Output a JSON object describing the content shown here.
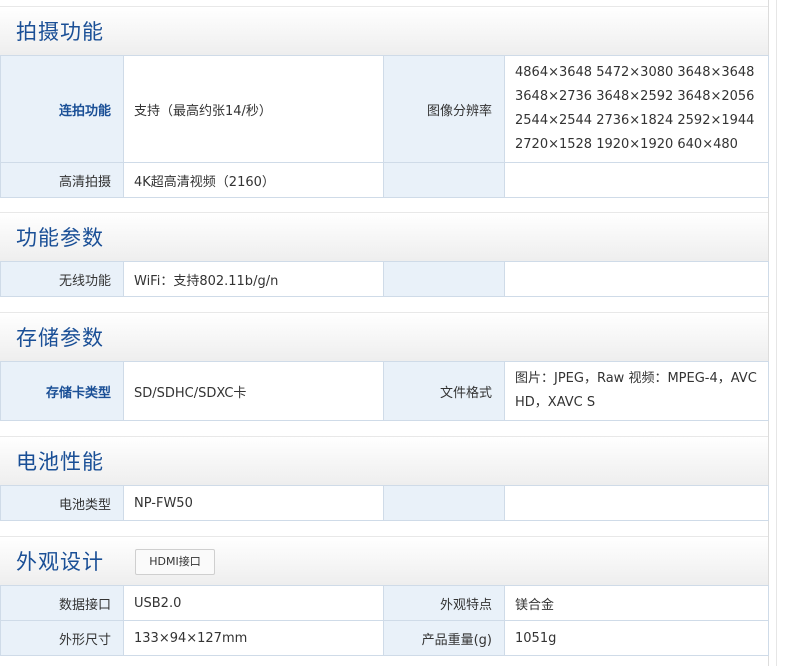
{
  "sections": [
    {
      "title": "拍摄功能",
      "rows": [
        {
          "label1": "连拍功能",
          "value1": "支持（最高约张14/秒）",
          "label2": "图像分辨率",
          "value2": "4864×3648 5472×3080 3648×3648 3648×2736 3648×2592 3648×2056 2544×2544 2736×1824 2592×1944 2720×1528 1920×1920 640×480"
        },
        {
          "label1": "高清拍摄",
          "value1": "4K超高清视频（2160）",
          "label2": "",
          "value2": ""
        }
      ]
    },
    {
      "title": "功能参数",
      "rows": [
        {
          "label1": "无线功能",
          "value1": "WiFi：支持802.11b/g/n",
          "label2": "",
          "value2": ""
        }
      ]
    },
    {
      "title": "存储参数",
      "rows": [
        {
          "label1": "存储卡类型",
          "value1": "SD/SDHC/SDXC卡",
          "label2": "文件格式",
          "value2": "图片：JPEG，Raw 视频：MPEG-4，AVCHD，XAVC S"
        }
      ]
    },
    {
      "title": "电池性能",
      "rows": [
        {
          "label1": "电池类型",
          "value1": "NP-FW50",
          "label2": "",
          "value2": ""
        }
      ]
    },
    {
      "title": "外观设计",
      "tag": "HDMI接口",
      "rows": [
        {
          "label1": "数据接口",
          "value1": "USB2.0",
          "label2": "外观特点",
          "value2": "镁合金"
        },
        {
          "label1": "外形尺寸",
          "value1": "133×94×127mm",
          "label2": "产品重量(g)",
          "value2": "1051g"
        }
      ]
    }
  ]
}
